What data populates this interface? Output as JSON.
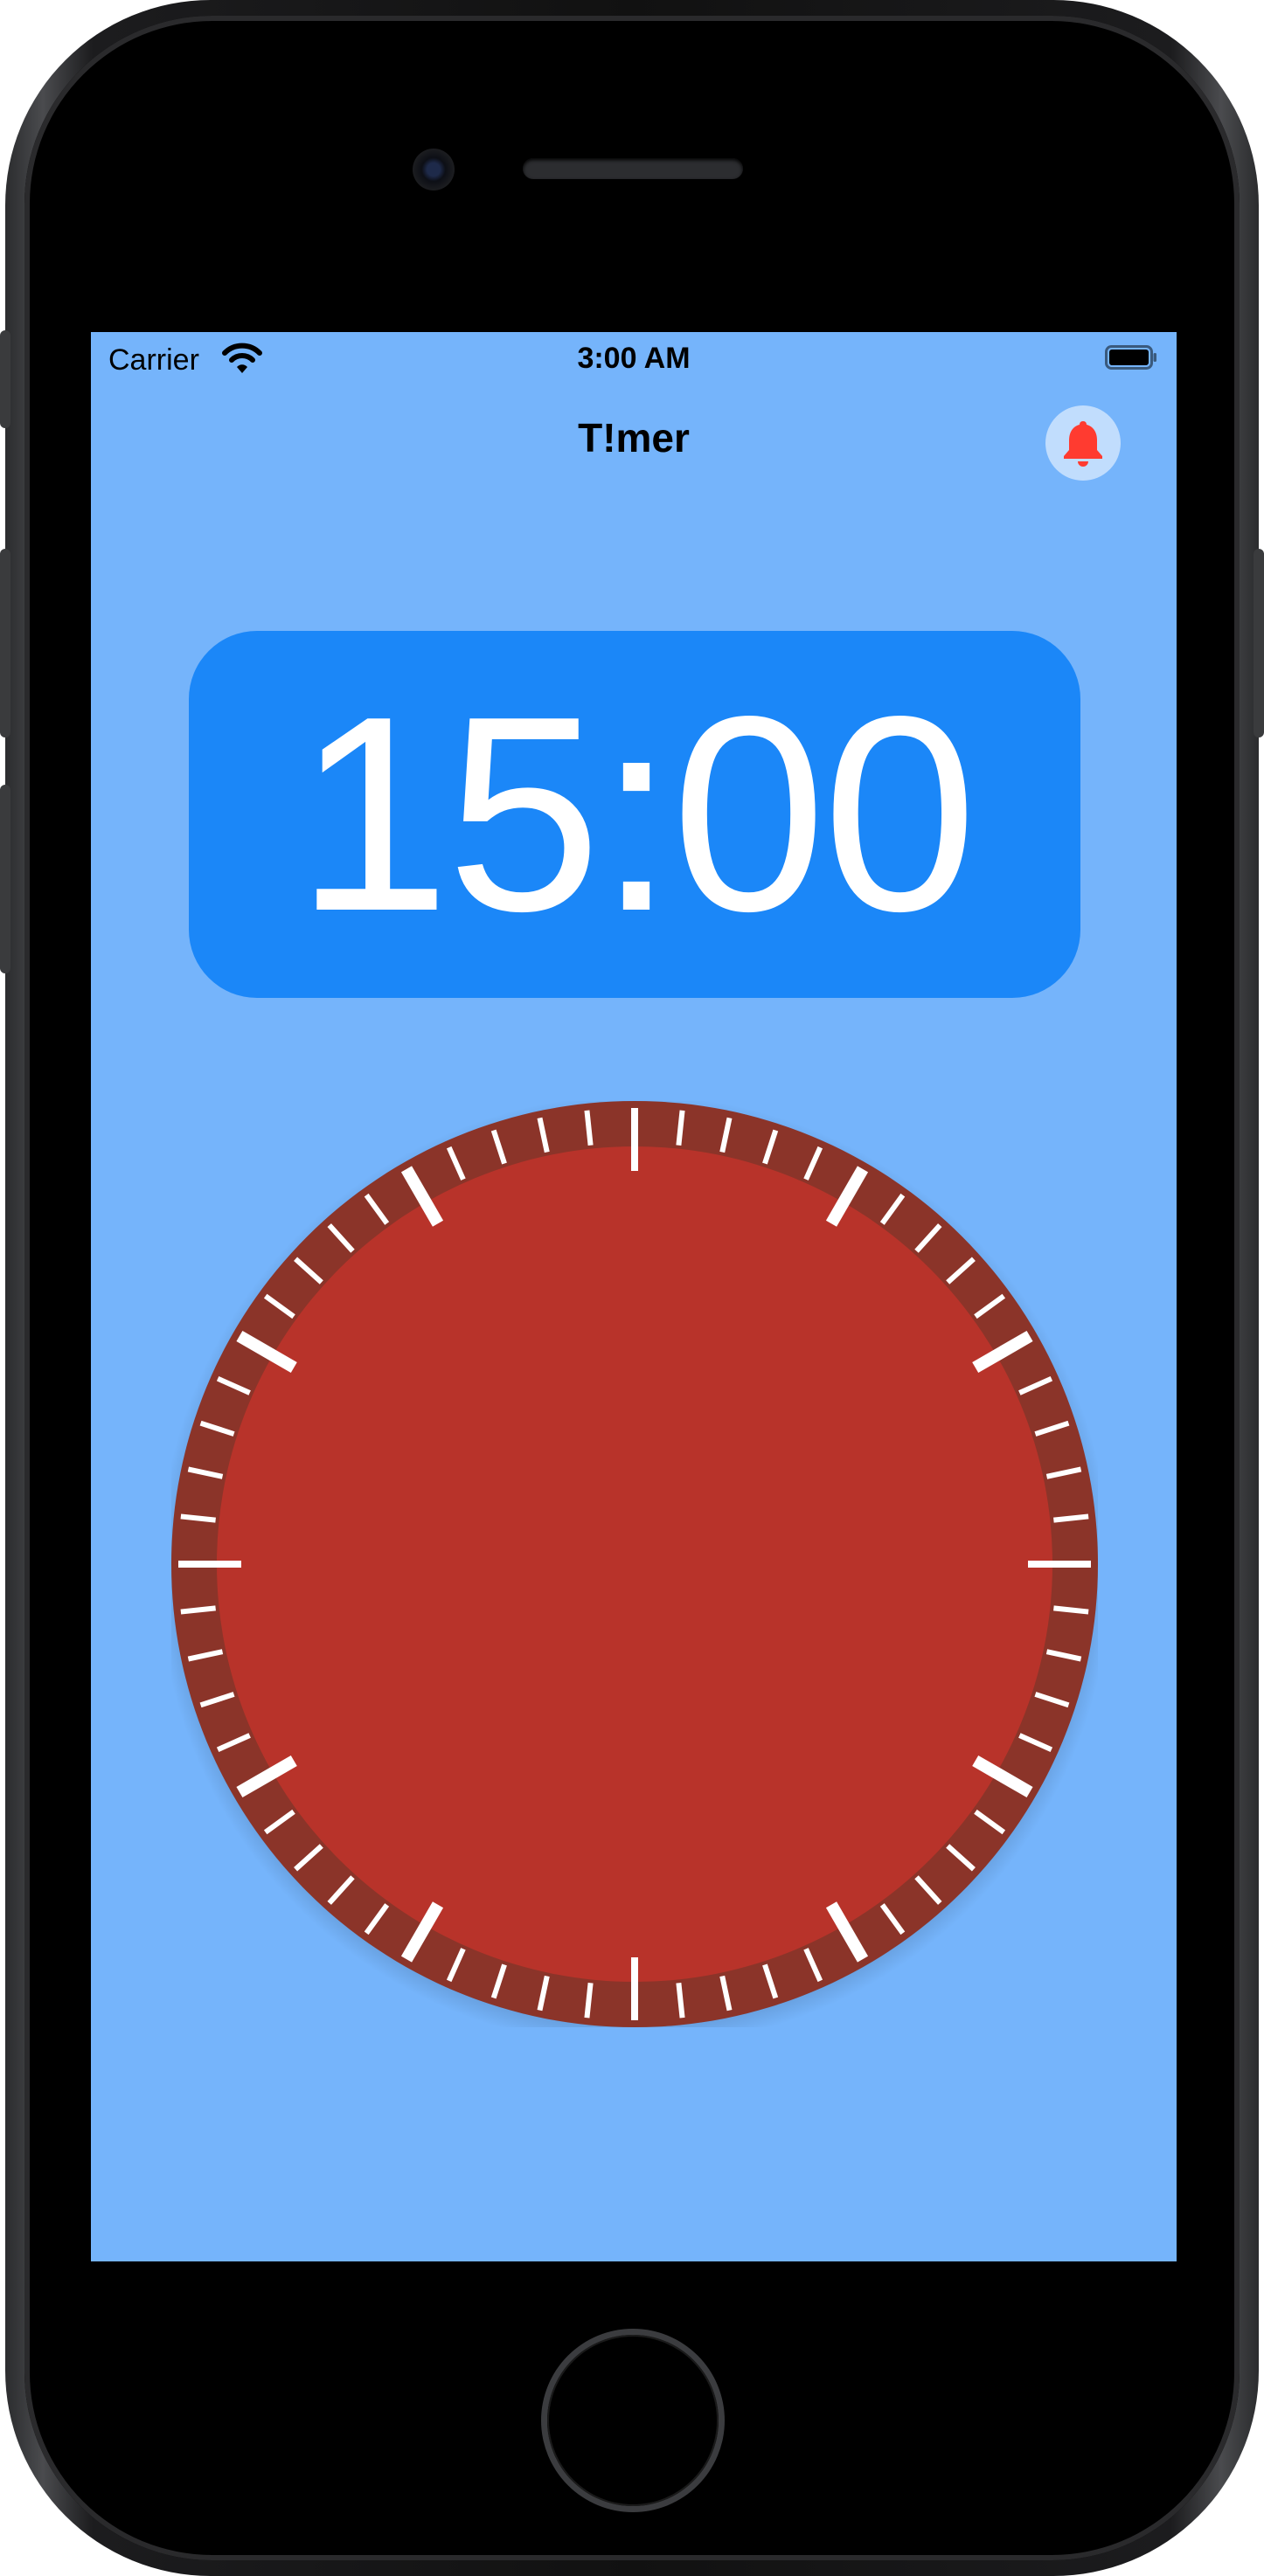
{
  "status_bar": {
    "carrier": "Carrier",
    "time": "3:00 AM",
    "wifi_icon": "wifi-icon",
    "battery_icon": "battery-icon"
  },
  "nav": {
    "title": "T!mer",
    "bell_icon": "bell-icon"
  },
  "timer": {
    "display": "15:00"
  },
  "dial": {
    "tick_count": 60,
    "major_every": 5
  },
  "colors": {
    "background": "#75b4fb",
    "time_box": "#1b87f8",
    "dial_face": "#b8332a",
    "dial_ring": "#8b3429",
    "ticks": "#ffffff",
    "bell": "#ff3b30"
  }
}
